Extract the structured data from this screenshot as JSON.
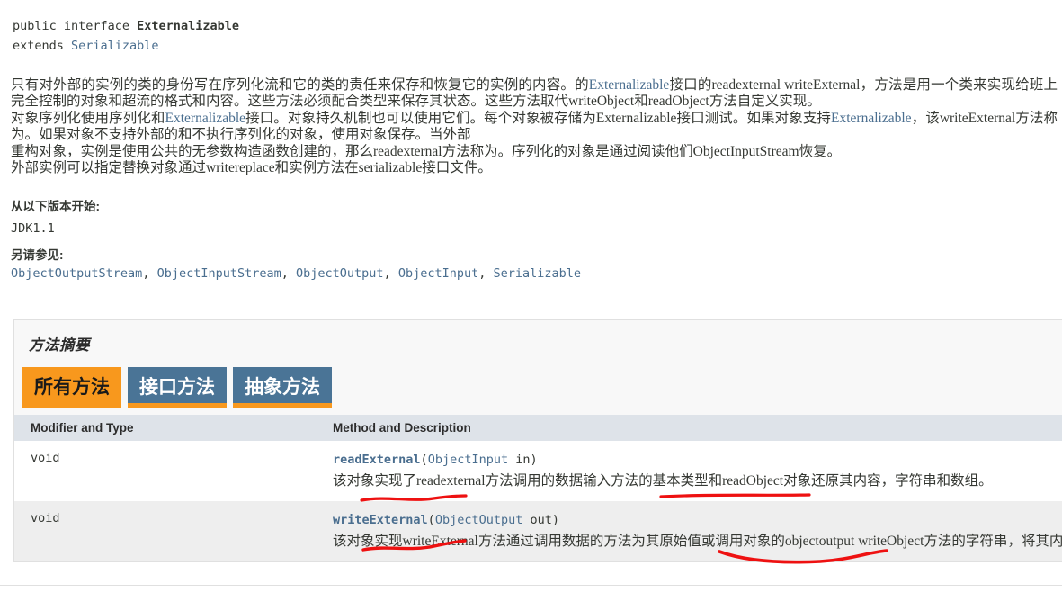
{
  "declaration": {
    "line1_prefix": "public interface ",
    "line1_type": "Externalizable",
    "line2_prefix": "extends ",
    "line2_link": "Serializable"
  },
  "description": {
    "segments": [
      {
        "text": "只有对外部的实例的类的身份写在序列化流和它的类的责任来保存和恢复它的实例的内容。的",
        "style": "plain"
      },
      {
        "text": "Externalizable",
        "style": "link"
      },
      {
        "text": "接口的",
        "style": "plain"
      },
      {
        "text": "readexternal writeExternal",
        "style": "code"
      },
      {
        "text": "，方法是用一个类来实现给班上完全控制的对象和超流的格式和内容。这些方法必须配合类型来保存其状态。这些方法取代",
        "style": "plain"
      },
      {
        "text": "writeObject",
        "style": "code"
      },
      {
        "text": "和",
        "style": "plain"
      },
      {
        "text": "readObject",
        "style": "code"
      },
      {
        "text": "方法自定义实现。",
        "style": "plain"
      }
    ],
    "line3": [
      {
        "text": "对象序列化使用序列化和",
        "style": "plain"
      },
      {
        "text": "Externalizable",
        "style": "link"
      },
      {
        "text": "接口。对象持久机制也可以使用它们。每个对象被存储为",
        "style": "plain"
      },
      {
        "text": "Externalizable",
        "style": "code"
      },
      {
        "text": "接口测试。如果对象支持",
        "style": "plain"
      },
      {
        "text": "Externalizable",
        "style": "link"
      },
      {
        "text": "，该",
        "style": "plain"
      },
      {
        "text": "writeExternal",
        "style": "code"
      },
      {
        "text": "方法称为。如果对象不支持外部的和不执行序列化的对象，使用对象保存。当外部",
        "style": "plain"
      }
    ],
    "line5": [
      {
        "text": "重构对象，实例是使用公共的无参数构造函数创建的，那么",
        "style": "plain"
      },
      {
        "text": "readexternal",
        "style": "code"
      },
      {
        "text": "方法称为。序列化的对象是通过阅读他们",
        "style": "plain"
      },
      {
        "text": "ObjectInputStream",
        "style": "code"
      },
      {
        "text": "恢复。",
        "style": "plain"
      }
    ],
    "line6": [
      {
        "text": "外部实例可以指定替换对象通过",
        "style": "plain"
      },
      {
        "text": "writereplace",
        "style": "code"
      },
      {
        "text": "和实例方法在",
        "style": "plain"
      },
      {
        "text": "serializable",
        "style": "code"
      },
      {
        "text": "接口文件。",
        "style": "plain"
      }
    ]
  },
  "since": {
    "heading": "从以下版本开始:",
    "value": "JDK1.1"
  },
  "see_also": {
    "heading": "另请参见:",
    "links": [
      "ObjectOutputStream",
      "ObjectInputStream",
      "ObjectOutput",
      "ObjectInput",
      "Serializable"
    ],
    "separator": ",  "
  },
  "method_summary": {
    "title": "方法摘要",
    "tabs": [
      {
        "label": "所有方法",
        "state": "active"
      },
      {
        "label": "接口方法",
        "state": "inactive"
      },
      {
        "label": "抽象方法",
        "state": "inactive"
      }
    ],
    "columns": [
      "Modifier and Type",
      "Method and Description"
    ],
    "rows": [
      {
        "modifier": "void",
        "method_name": "readExternal",
        "method_params_open": "(",
        "method_param_type": "ObjectInput",
        "method_param_name": " in",
        "method_params_close": ")",
        "description": "该对象实现了readexternal方法调用的数据输入方法的基本类型和readObject对象还原其内容，字符串和数组。"
      },
      {
        "modifier": "void",
        "method_name": "writeExternal",
        "method_params_open": "(",
        "method_param_type": "ObjectOutput",
        "method_param_name": " out",
        "method_params_close": ")",
        "description": "该对象实现writeExternal方法通过调用数据的方法为其原始值或调用对象的objectoutput writeObject方法的字符串，将其内容，和阵列。"
      }
    ]
  },
  "colors": {
    "accent_orange": "#f8981d",
    "tab_blue": "#4a7496",
    "link_blue": "#4a6e8f",
    "table_header_bg": "#dee3e9",
    "alt_row_bg": "#eeeeee",
    "annotation_red": "#ee1111"
  },
  "annotations": [
    {
      "name": "underline-readexternal",
      "color": "#ee1111"
    },
    {
      "name": "underline-readobject",
      "color": "#ee1111"
    },
    {
      "name": "underline-writeexternal",
      "color": "#ee1111"
    },
    {
      "name": "underline-objectoutput-writeobject",
      "color": "#ee1111"
    }
  ]
}
